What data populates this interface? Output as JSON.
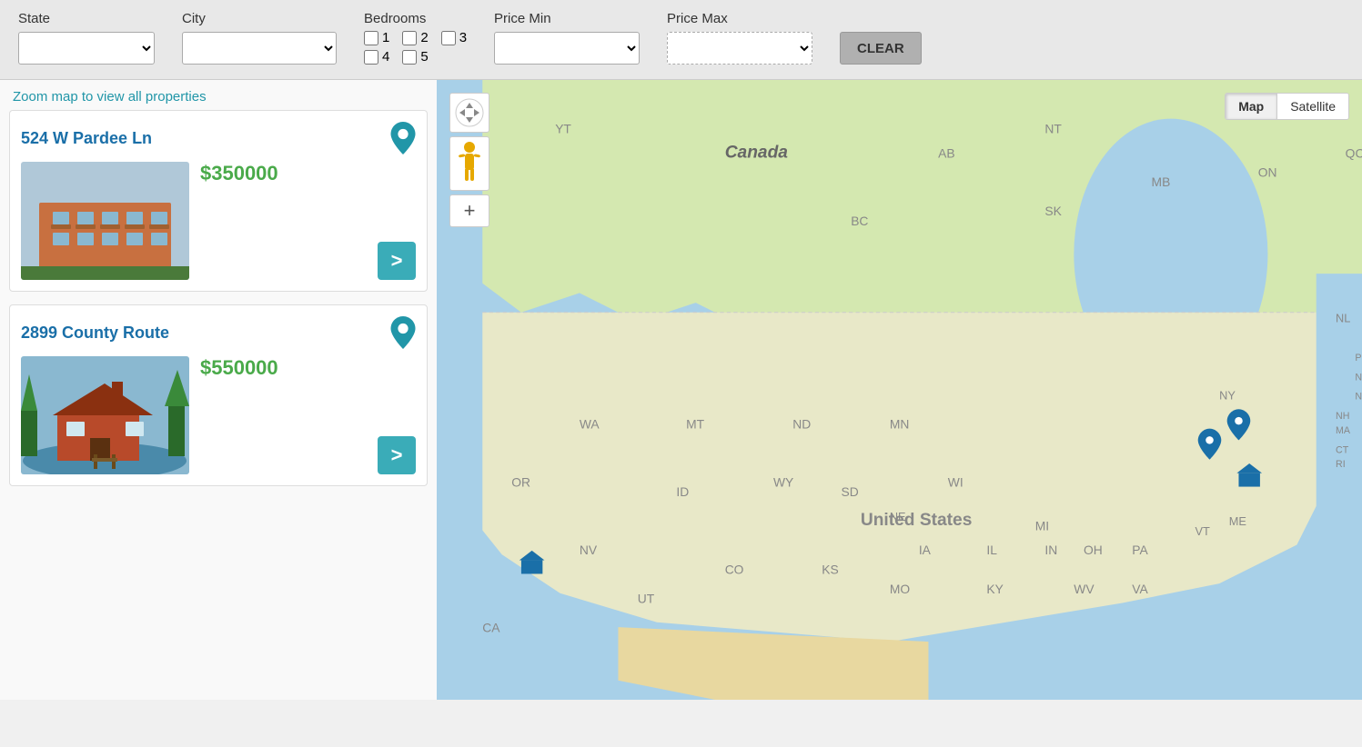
{
  "filters": {
    "state_label": "State",
    "city_label": "City",
    "bedrooms_label": "Bedrooms",
    "price_min_label": "Price Min",
    "price_max_label": "Price Max",
    "clear_label": "CLEAR",
    "bedroom_options": [
      "1",
      "2",
      "3",
      "4",
      "5"
    ],
    "state_placeholder": "",
    "city_placeholder": ""
  },
  "zoom_hint": "Zoom map to view all properties",
  "listings": [
    {
      "title": "524 W Pardee Ln",
      "price": "$350000",
      "arrow": ">",
      "bg_top": "#c8dde8",
      "bg_bottom": "#7a9ab0"
    },
    {
      "title": "2899 County Route",
      "price": "$550000",
      "arrow": ">",
      "bg_top": "#6aaa5a",
      "bg_bottom": "#4a7a3a"
    }
  ],
  "map": {
    "type_map": "Map",
    "type_satellite": "Satellite"
  }
}
